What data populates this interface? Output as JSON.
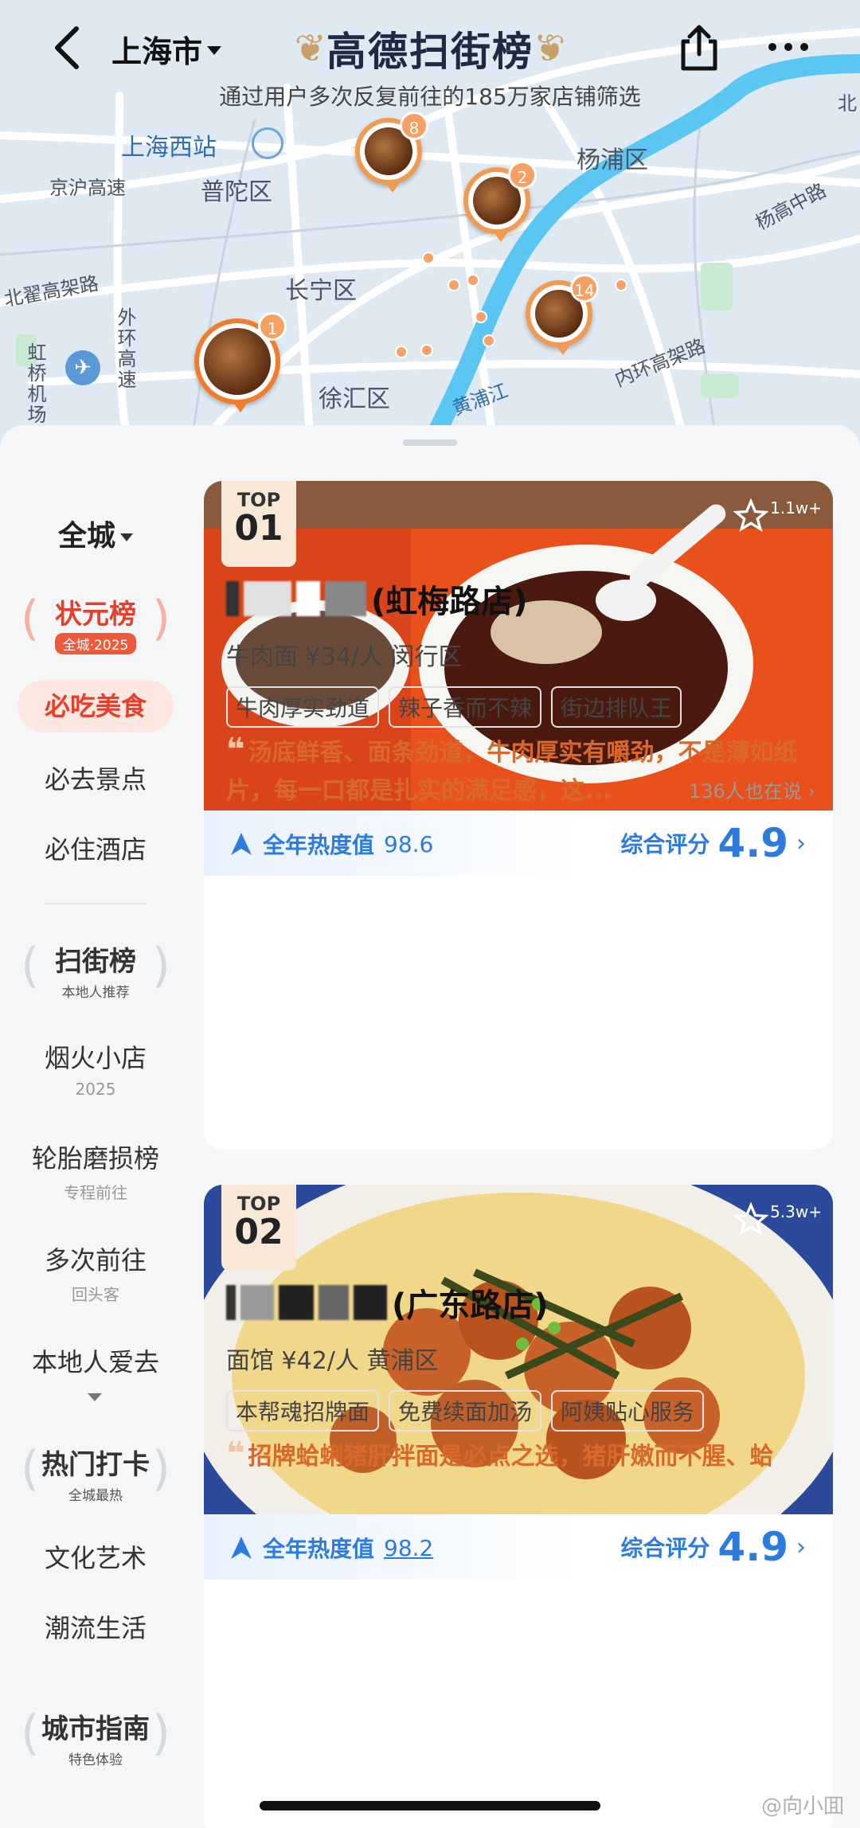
{
  "header": {
    "city": "上海市",
    "title": "高德扫街榜",
    "subtitle": "通过用户多次反复前往的185万家店铺筛选"
  },
  "map": {
    "labels": [
      "上海西站",
      "杨浦区",
      "京沪高速",
      "普陀区",
      "杨高中路",
      "北翟高架路",
      "长宁区",
      "外环高速",
      "虹桥机场",
      "内环高架路",
      "徐汇区",
      "黄浦江",
      "北"
    ],
    "pins": [
      "8",
      "2",
      "14",
      "1"
    ]
  },
  "sidebar": {
    "scope": "全城",
    "sections": [
      {
        "title": "状元榜",
        "sub": "全城·2025"
      },
      {
        "title": "扫街榜",
        "sub": "本地人推荐"
      },
      {
        "title": "热门打卡",
        "sub": "全城最热"
      },
      {
        "title": "城市指南",
        "sub": "特色体验"
      }
    ],
    "items": [
      {
        "label": "必吃美食"
      },
      {
        "label": "必去景点"
      },
      {
        "label": "必住酒店"
      },
      {
        "label": "烟火小店",
        "sub": "2025"
      },
      {
        "label": "轮胎磨损榜",
        "sub": "专程前往"
      },
      {
        "label": "多次前往",
        "sub": "回头客"
      },
      {
        "label": "本地人爱去"
      },
      {
        "label": "文化艺术"
      },
      {
        "label": "潮流生活"
      }
    ]
  },
  "cards": [
    {
      "rank_label": "TOP",
      "rank": "01",
      "fav_count": "1.1w+",
      "heat_label": "全年热度值",
      "heat_value": "98.6",
      "score_label": "综合评分",
      "score": "4.9",
      "name_visible": "(虹梅路店)",
      "meta": "牛肉面 ¥34/人 闵行区",
      "tags": [
        "牛肉厚实劲道",
        "辣子香而不辣",
        "街边排队王"
      ],
      "review": "汤底鲜香、面条劲道，牛肉厚实有嚼劲，不是薄如纸片，每一口都是扎实的满足感，这...",
      "review_count": "136人也在说"
    },
    {
      "rank_label": "TOP",
      "rank": "02",
      "fav_count": "5.3w+",
      "heat_label": "全年热度值",
      "heat_value": "98.2",
      "score_label": "综合评分",
      "score": "4.9",
      "name_visible": "(广东路店)",
      "meta": "面馆 ¥42/人 黄浦区",
      "tags": [
        "本帮魂招牌面",
        "免费续面加汤",
        "阿姨贴心服务"
      ],
      "review": "招牌蛤蜊猪肝拌面是必点之选，猪肝嫩而不腥、蛤"
    }
  ],
  "watermark": "@向小囬"
}
